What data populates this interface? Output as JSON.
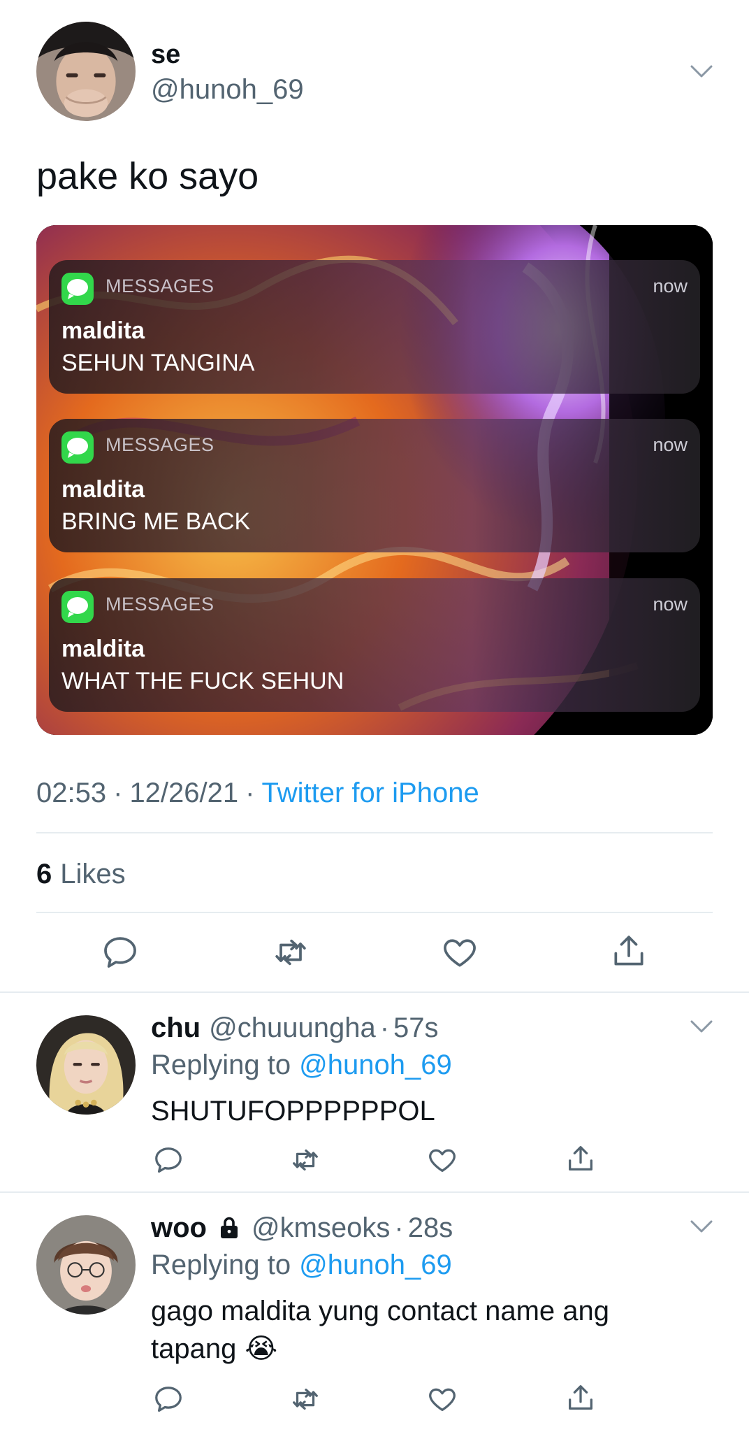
{
  "tweet": {
    "display_name": "se",
    "handle": "@hunoh_69",
    "text": "pake ko sayo",
    "notifications": [
      {
        "app": "MESSAGES",
        "time": "now",
        "sender": "maldita",
        "message": "SEHUN TANGINA"
      },
      {
        "app": "MESSAGES",
        "time": "now",
        "sender": "maldita",
        "message": "BRING ME BACK"
      },
      {
        "app": "MESSAGES",
        "time": "now",
        "sender": "maldita",
        "message": "WHAT THE FUCK SEHUN"
      }
    ],
    "time": "02:53",
    "date": "12/26/21",
    "separator": "·",
    "source": "Twitter for iPhone",
    "likes_count": "6",
    "likes_label": "Likes"
  },
  "replies": [
    {
      "display_name": "chu",
      "handle": "@chuuungha",
      "separator": "·",
      "age": "57s",
      "replying_prefix": "Replying to",
      "replying_handle": "@hunoh_69",
      "text": "SHUTUFOPPPPPPOL",
      "text_line2": ""
    },
    {
      "display_name": "woo",
      "protected_icon": "lock-icon",
      "handle": "@kmseoks",
      "separator": "·",
      "age": "28s",
      "replying_prefix": "Replying to",
      "replying_handle": "@hunoh_69",
      "text": "gago maldita yung contact name ang",
      "text_line2": "tapang",
      "emoji": "😭"
    }
  ],
  "colors": {
    "text": "#0f1419",
    "secondary": "#536471",
    "link": "#1d9bf0",
    "divider": "#e6ecf0",
    "messages_green": "#32d74b"
  },
  "icons": {
    "tweet_menu": "chevron-down-icon",
    "reply": "reply-icon",
    "retweet": "retweet-icon",
    "like": "heart-icon",
    "share": "share-icon",
    "messages": "messages-app-icon"
  }
}
